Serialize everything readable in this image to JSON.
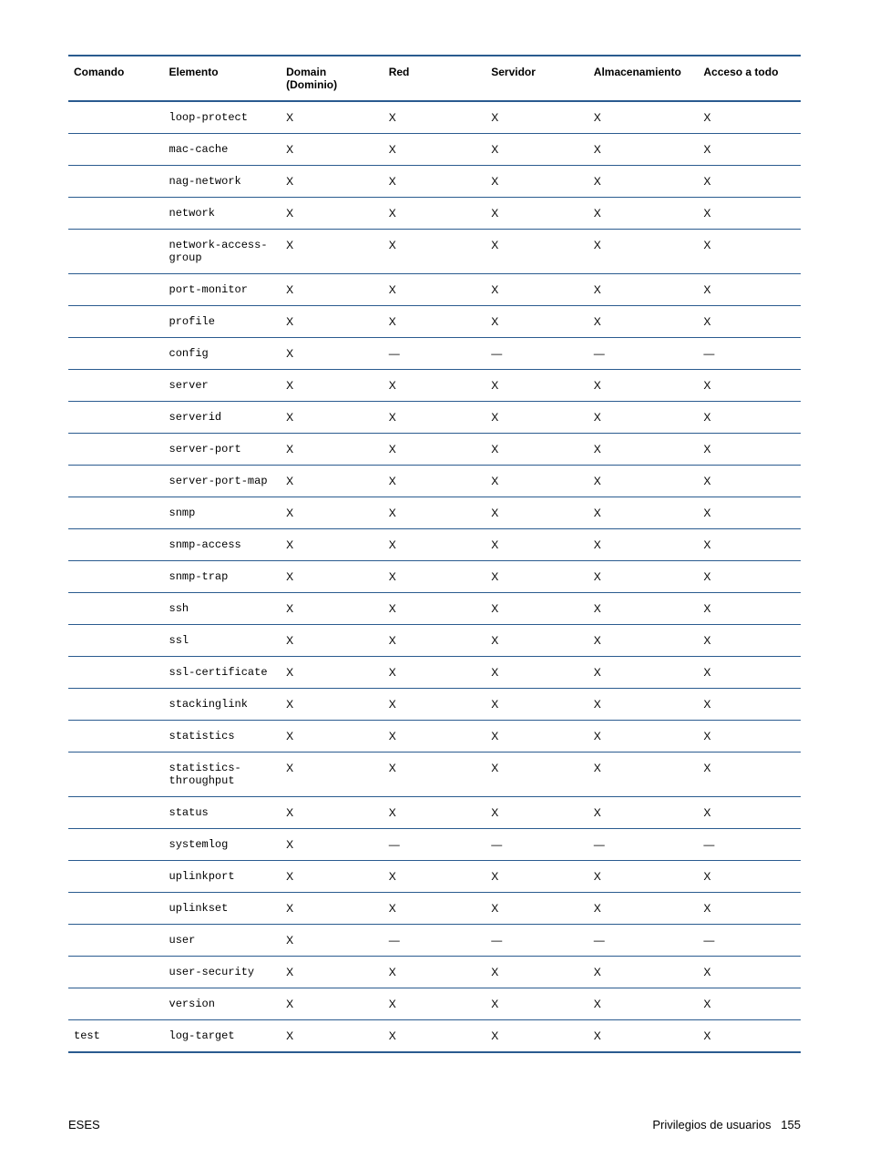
{
  "headers": {
    "comando": "Comando",
    "elemento": "Elemento",
    "domain": "Domain (Dominio)",
    "red": "Red",
    "servidor": "Servidor",
    "almac": "Almacenamiento",
    "acceso": "Acceso a todo"
  },
  "rows": [
    {
      "comando": "",
      "elemento": "loop-protect",
      "domain": "X",
      "red": "X",
      "servidor": "X",
      "almac": "X",
      "acceso": "X"
    },
    {
      "comando": "",
      "elemento": "mac-cache",
      "domain": "X",
      "red": "X",
      "servidor": "X",
      "almac": "X",
      "acceso": "X"
    },
    {
      "comando": "",
      "elemento": "nag-network",
      "domain": "X",
      "red": "X",
      "servidor": "X",
      "almac": "X",
      "acceso": "X"
    },
    {
      "comando": "",
      "elemento": "network",
      "domain": "X",
      "red": "X",
      "servidor": "X",
      "almac": "X",
      "acceso": "X"
    },
    {
      "comando": "",
      "elemento": "network-access-group",
      "domain": "X",
      "red": "X",
      "servidor": "X",
      "almac": "X",
      "acceso": "X"
    },
    {
      "comando": "",
      "elemento": "port-monitor",
      "domain": "X",
      "red": "X",
      "servidor": "X",
      "almac": "X",
      "acceso": "X"
    },
    {
      "comando": "",
      "elemento": "profile",
      "domain": "X",
      "red": "X",
      "servidor": "X",
      "almac": "X",
      "acceso": "X"
    },
    {
      "comando": "",
      "elemento": "config",
      "domain": "X",
      "red": "—",
      "servidor": "—",
      "almac": "—",
      "acceso": "—"
    },
    {
      "comando": "",
      "elemento": "server",
      "domain": "X",
      "red": "X",
      "servidor": "X",
      "almac": "X",
      "acceso": "X"
    },
    {
      "comando": "",
      "elemento": "serverid",
      "domain": "X",
      "red": "X",
      "servidor": "X",
      "almac": "X",
      "acceso": "X"
    },
    {
      "comando": "",
      "elemento": "server-port",
      "domain": "X",
      "red": "X",
      "servidor": "X",
      "almac": "X",
      "acceso": "X"
    },
    {
      "comando": "",
      "elemento": "server-port-map",
      "domain": "X",
      "red": "X",
      "servidor": "X",
      "almac": "X",
      "acceso": "X"
    },
    {
      "comando": "",
      "elemento": "snmp",
      "domain": "X",
      "red": "X",
      "servidor": "X",
      "almac": "X",
      "acceso": "X"
    },
    {
      "comando": "",
      "elemento": "snmp-access",
      "domain": "X",
      "red": "X",
      "servidor": "X",
      "almac": "X",
      "acceso": "X"
    },
    {
      "comando": "",
      "elemento": "snmp-trap",
      "domain": "X",
      "red": "X",
      "servidor": "X",
      "almac": "X",
      "acceso": "X"
    },
    {
      "comando": "",
      "elemento": "ssh",
      "domain": "X",
      "red": "X",
      "servidor": "X",
      "almac": "X",
      "acceso": "X"
    },
    {
      "comando": "",
      "elemento": "ssl",
      "domain": "X",
      "red": "X",
      "servidor": "X",
      "almac": "X",
      "acceso": "X"
    },
    {
      "comando": "",
      "elemento": "ssl-certificate",
      "domain": "X",
      "red": "X",
      "servidor": "X",
      "almac": "X",
      "acceso": "X"
    },
    {
      "comando": "",
      "elemento": "stackinglink",
      "domain": "X",
      "red": "X",
      "servidor": "X",
      "almac": "X",
      "acceso": "X"
    },
    {
      "comando": "",
      "elemento": "statistics",
      "domain": "X",
      "red": "X",
      "servidor": "X",
      "almac": "X",
      "acceso": "X"
    },
    {
      "comando": "",
      "elemento": "statistics-throughput",
      "domain": "X",
      "red": "X",
      "servidor": "X",
      "almac": "X",
      "acceso": "X"
    },
    {
      "comando": "",
      "elemento": "status",
      "domain": "X",
      "red": "X",
      "servidor": "X",
      "almac": "X",
      "acceso": "X"
    },
    {
      "comando": "",
      "elemento": "systemlog",
      "domain": "X",
      "red": "—",
      "servidor": "—",
      "almac": "—",
      "acceso": "—"
    },
    {
      "comando": "",
      "elemento": "uplinkport",
      "domain": "X",
      "red": "X",
      "servidor": "X",
      "almac": "X",
      "acceso": "X"
    },
    {
      "comando": "",
      "elemento": "uplinkset",
      "domain": "X",
      "red": "X",
      "servidor": "X",
      "almac": "X",
      "acceso": "X"
    },
    {
      "comando": "",
      "elemento": "user",
      "domain": "X",
      "red": "—",
      "servidor": "—",
      "almac": "—",
      "acceso": "—"
    },
    {
      "comando": "",
      "elemento": "user-security",
      "domain": "X",
      "red": "X",
      "servidor": "X",
      "almac": "X",
      "acceso": "X"
    },
    {
      "comando": "",
      "elemento": "version",
      "domain": "X",
      "red": "X",
      "servidor": "X",
      "almac": "X",
      "acceso": "X"
    },
    {
      "comando": "test",
      "elemento": "log-target",
      "domain": "X",
      "red": "X",
      "servidor": "X",
      "almac": "X",
      "acceso": "X"
    }
  ],
  "footer": {
    "left": "ESES",
    "right_text": "Privilegios de usuarios",
    "page": "155"
  }
}
